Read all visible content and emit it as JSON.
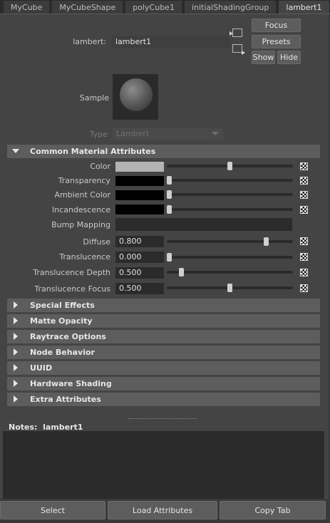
{
  "tabs": [
    {
      "label": "MyCube",
      "active": false
    },
    {
      "label": "MyCubeShape",
      "active": false
    },
    {
      "label": "polyCube1",
      "active": false
    },
    {
      "label": "initialShadingGroup",
      "active": false
    },
    {
      "label": "lambert1",
      "active": true
    }
  ],
  "header": {
    "node_type_label": "lambert:",
    "node_name": "lambert1",
    "buttons": {
      "focus": "Focus",
      "presets": "Presets",
      "show": "Show",
      "hide": "Hide"
    }
  },
  "sample": {
    "label": "Sample"
  },
  "type_field": {
    "label": "Type",
    "value": "Lambert"
  },
  "sections": {
    "common": "Common Material Attributes",
    "collapsed": [
      "Special Effects",
      "Matte Opacity",
      "Raytrace Options",
      "Node Behavior",
      "UUID",
      "Hardware Shading",
      "Extra Attributes"
    ]
  },
  "attributes": {
    "color": {
      "label": "Color",
      "swatch": "#b3b3b3",
      "slider": 0.5
    },
    "transparency": {
      "label": "Transparency",
      "swatch": "#000000",
      "slider": 0.0
    },
    "ambient": {
      "label": "Ambient Color",
      "swatch": "#000000",
      "slider": 0.0
    },
    "incandescence": {
      "label": "Incandescence",
      "swatch": "#000000",
      "slider": 0.0
    },
    "bump": {
      "label": "Bump Mapping"
    },
    "diffuse": {
      "label": "Diffuse",
      "value": "0.800",
      "slider": 0.8
    },
    "translucence": {
      "label": "Translucence",
      "value": "0.000",
      "slider": 0.0
    },
    "translucence_depth": {
      "label": "Translucence Depth",
      "value": "0.500",
      "slider": 0.1
    },
    "translucence_focus": {
      "label": "Translucence Focus",
      "value": "0.500",
      "slider": 0.5
    }
  },
  "notes": {
    "label": "Notes:",
    "node": "lambert1"
  },
  "footer": {
    "select": "Select",
    "load": "Load Attributes",
    "copy": "Copy Tab"
  }
}
